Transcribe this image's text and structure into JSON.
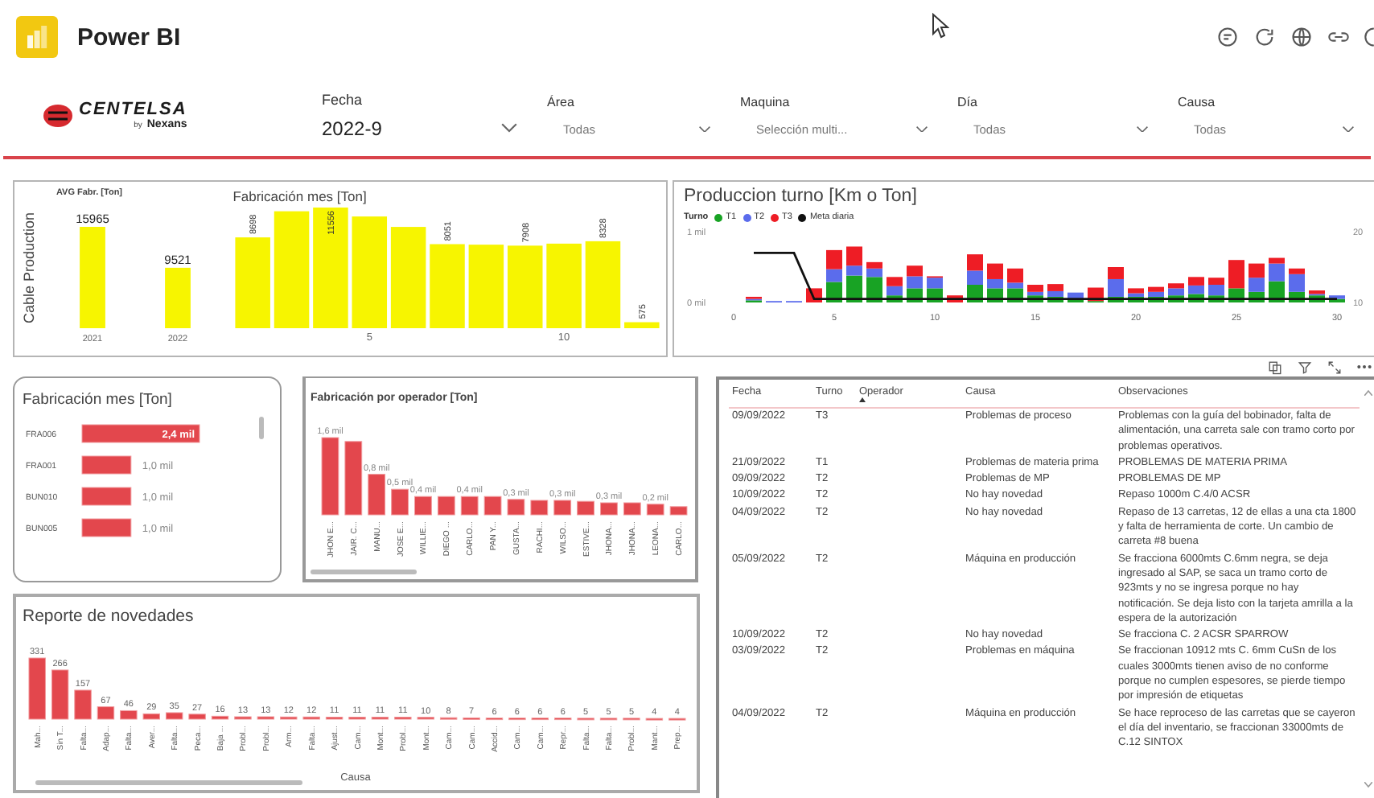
{
  "header": {
    "app": "Power BI"
  },
  "logo": {
    "name": "CENTELSA",
    "by": "by",
    "brand": "Nexans"
  },
  "slicers": [
    {
      "label": "Fecha",
      "value": "2022-9",
      "kind": "large"
    },
    {
      "label": "Área",
      "value": "Todas",
      "kind": "small"
    },
    {
      "label": "Maquina",
      "value": "Selección multi...",
      "kind": "small"
    },
    {
      "label": "Día",
      "value": "Todas",
      "kind": "small"
    },
    {
      "label": "Causa",
      "value": "Todas",
      "kind": "small"
    }
  ],
  "cable_production": {
    "label": "Cable Production",
    "avg": {
      "title": "AVG Fabr. [Ton]",
      "chart_data": {
        "type": "bar",
        "categories": [
          "2021",
          "2022"
        ],
        "values": [
          15965,
          9521
        ],
        "value_labels": [
          "15965",
          "9521"
        ]
      }
    },
    "monthly": {
      "title": "Fabricación mes [Ton]",
      "chart_data": {
        "type": "bar",
        "x": [
          2,
          3,
          4,
          5,
          6,
          7,
          8,
          9,
          10,
          11,
          12
        ],
        "xlim": [
          1.5,
          12.5
        ],
        "xticks": [
          5,
          10
        ],
        "values": [
          8698,
          11200,
          11556,
          10700,
          9700,
          8051,
          8000,
          7908,
          8100,
          8328,
          575
        ],
        "value_labels": [
          "8698",
          null,
          "11556",
          null,
          null,
          "8051",
          null,
          "7908",
          null,
          "8328",
          "575"
        ]
      }
    }
  },
  "turno": {
    "title": "Produccion turno [Km o Ton]",
    "legend_title": "Turno",
    "chart_data": {
      "type": "bar",
      "stacked": true,
      "x": [
        1,
        2,
        3,
        4,
        5,
        6,
        7,
        8,
        9,
        10,
        11,
        12,
        13,
        14,
        15,
        16,
        17,
        18,
        19,
        20,
        21,
        22,
        23,
        24,
        25,
        26,
        27,
        28,
        29,
        30
      ],
      "xlim": [
        0,
        30
      ],
      "xticks": [
        0,
        5,
        10,
        15,
        20,
        25,
        30
      ],
      "ylim": [
        0,
        1
      ],
      "yticks": [
        {
          "value": 0,
          "label": "0 mil"
        },
        {
          "value": 1,
          "label": "1 mil"
        }
      ],
      "y2lim": [
        10,
        20
      ],
      "y2ticks": [
        10,
        20
      ],
      "series": [
        {
          "name": "T1",
          "color": "#18a324",
          "values": [
            0.03,
            0,
            0,
            0,
            0.29,
            0.38,
            0.36,
            0.1,
            0.2,
            0.2,
            0,
            0.25,
            0.2,
            0.2,
            0.1,
            0.08,
            0.05,
            0.02,
            0.08,
            0.08,
            0.08,
            0.1,
            0.12,
            0.1,
            0.2,
            0.15,
            0.3,
            0.15,
            0.1,
            0.05
          ]
        },
        {
          "name": "T2",
          "color": "#5b6cec",
          "values": [
            0.02,
            0.02,
            0.02,
            0,
            0.18,
            0.14,
            0.12,
            0.13,
            0.17,
            0.15,
            0,
            0.2,
            0.13,
            0.08,
            0.05,
            0.08,
            0.09,
            0,
            0.25,
            0.05,
            0.07,
            0.1,
            0.12,
            0.15,
            0,
            0.2,
            0.25,
            0.25,
            0.02,
            0.05
          ]
        },
        {
          "name": "T3",
          "color": "#ee1d25",
          "values": [
            0.03,
            0,
            0,
            0.2,
            0.27,
            0.27,
            0.09,
            0.13,
            0.15,
            0.02,
            0.1,
            0.23,
            0.22,
            0.2,
            0.1,
            0.1,
            0,
            0.19,
            0.17,
            0.07,
            0.07,
            0.07,
            0.12,
            0.1,
            0.4,
            0.2,
            0.08,
            0.08,
            0.05,
            0
          ]
        },
        {
          "name": "Meta diaria",
          "color": "#111111",
          "type": "line",
          "axis": "y2",
          "values": [
            17,
            17,
            17,
            10.5,
            10.5,
            10.5,
            10.5,
            10.5,
            10.5,
            10.5,
            10.5,
            10.5,
            10.5,
            10.5,
            10.5,
            10.5,
            10.5,
            10.5,
            10.5,
            10.5,
            10.5,
            10.5,
            10.5,
            10.5,
            10.5,
            10.5,
            10.5,
            10.5,
            10.5,
            10.5
          ]
        }
      ]
    }
  },
  "machines": {
    "title": "Fabricación mes [Ton]",
    "chart_data": {
      "type": "bar",
      "orientation": "horizontal",
      "categories": [
        "FRA006",
        "FRA001",
        "BUN010",
        "BUN005"
      ],
      "values": [
        2.4,
        1.0,
        1.0,
        1.0
      ],
      "value_labels": [
        "2,4 mil",
        "1,0 mil",
        "1,0 mil",
        "1,0 mil"
      ]
    }
  },
  "operators": {
    "title": "Fabricación por operador [Ton]",
    "chart_data": {
      "type": "bar",
      "categories": [
        "JHON E...",
        "JAIR. C...",
        "MANU...",
        "JOSE E...",
        "WILLIE...",
        "DIEGO ...",
        "CARLO...",
        "PAN Y...",
        "GUSTA...",
        "RACHI...",
        "WILSO...",
        "ESTIVE...",
        "JHONA...",
        "JHONA...",
        "LEONA...",
        "CARLO..."
      ],
      "values": [
        1.6,
        1.52,
        0.84,
        0.53,
        0.38,
        0.38,
        0.38,
        0.38,
        0.32,
        0.3,
        0.3,
        0.28,
        0.25,
        0.25,
        0.22,
        0.17
      ],
      "value_labels": [
        "1,6 mil",
        null,
        "0,8 mil",
        "0,5 mil",
        "0,4 mil",
        null,
        "0,4 mil",
        null,
        "0,3 mil",
        null,
        "0,3 mil",
        null,
        "0,3 mil",
        null,
        "0,2 mil",
        null
      ]
    }
  },
  "report": {
    "title": "Reporte de novedades",
    "chart_data": {
      "type": "bar",
      "xlabel": "Causa",
      "categories": [
        "Mah...",
        "Sin T...",
        "Falta...",
        "Adap...",
        "Falta...",
        "Aver...",
        "Falta...",
        "Peca...",
        "Baja ...",
        "Probl...",
        "Probl...",
        "Arm...",
        "Falta...",
        "Ajust...",
        "Cam...",
        "Mont...",
        "Probl...",
        "Mont...",
        "Cam...",
        "Cam...",
        "Accid...",
        "Cam...",
        "Cam...",
        "Repr...",
        "Falta...",
        "Falta...",
        "Probl...",
        "Mant...",
        "Prep..."
      ],
      "values": [
        331,
        266,
        157,
        67,
        46,
        29,
        35,
        27,
        16,
        13,
        13,
        12,
        12,
        11,
        11,
        11,
        11,
        10,
        8,
        7,
        6,
        6,
        6,
        6,
        5,
        5,
        5,
        4,
        4
      ],
      "value_labels": [
        "331",
        "266",
        "157",
        "67",
        "46",
        "29",
        "35",
        "27",
        "16",
        "13",
        "13",
        "12",
        "12",
        "11",
        "11",
        "11",
        "11",
        "10",
        "8",
        "7",
        "6",
        "6",
        "6",
        "6",
        "5",
        "5",
        "5",
        "4",
        "4"
      ]
    }
  },
  "table": {
    "columns": [
      {
        "label": "Fecha",
        "sorted": false
      },
      {
        "label": "Turno",
        "sorted": false
      },
      {
        "label": "Operador",
        "sorted": true
      },
      {
        "label": "Causa",
        "sorted": false
      },
      {
        "label": "Observaciones",
        "sorted": false
      }
    ],
    "rows": [
      {
        "fecha": "09/09/2022",
        "turno": "T3",
        "causa": "Problemas de proceso",
        "observaciones": "Problemas con la guía del bobinador, falta de alimentación, una carreta sale con tramo corto por problemas operativos."
      },
      {
        "fecha": "21/09/2022",
        "turno": "T1",
        "causa": "Problemas de materia prima",
        "observaciones": "PROBLEMAS DE MATERIA PRIMA"
      },
      {
        "fecha": "09/09/2022",
        "turno": "T2",
        "causa": "Problemas de MP",
        "observaciones": "PROBLEMAS DE MP"
      },
      {
        "fecha": "10/09/2022",
        "turno": "T2",
        "causa": "No hay novedad",
        "observaciones": "Repaso 1000m C.4/0 ACSR"
      },
      {
        "fecha": "04/09/2022",
        "turno": "T2",
        "causa": "No hay novedad",
        "observaciones": "Repaso de 13 carretas, 12 de ellas a una cta 1800 y falta de herramienta de corte. Un cambio de carreta #8 buena"
      },
      {
        "fecha": "05/09/2022",
        "turno": "T2",
        "causa": "Máquina en producción",
        "observaciones": "Se fracciona 6000mts C.6mm negra, se deja ingresado al SAP, se saca un tramo corto de 923mts y no se ingresa porque no hay notificación. Se deja listo con la tarjeta amrilla a la espera de la autorización"
      },
      {
        "fecha": "10/09/2022",
        "turno": "T2",
        "causa": "No hay novedad",
        "observaciones": "Se fracciona C. 2 ACSR SPARROW"
      },
      {
        "fecha": "03/09/2022",
        "turno": "T2",
        "causa": "Problemas en máquina",
        "observaciones": "Se fraccionan 10912 mts C. 6mm CuSn de los cuales 3000mts tienen aviso de no conforme porque no cumplen espesores, se pierde tiempo por impresión de etiquetas"
      },
      {
        "fecha": "04/09/2022",
        "turno": "T2",
        "causa": "Máquina en producción",
        "observaciones": "Se hace reproceso de las carretas que se cayeron el día del inventario, se fraccionan 33000mts de C.12 SINTOX"
      }
    ]
  }
}
